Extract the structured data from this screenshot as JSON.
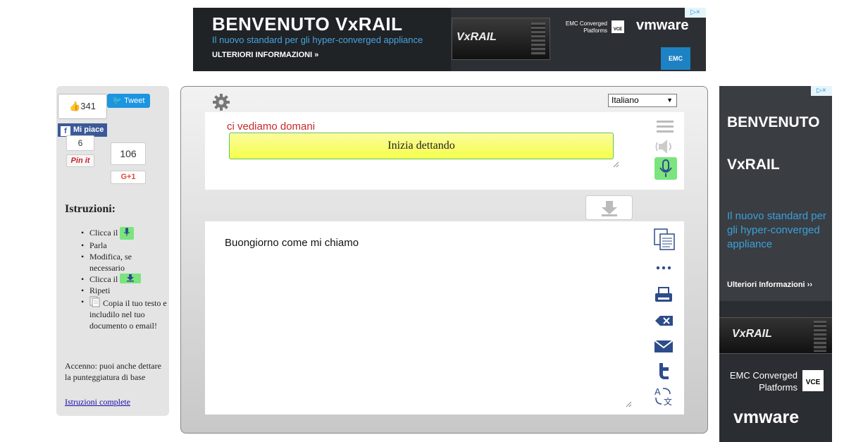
{
  "top_ad": {
    "headline": "BENVENUTO VxRAIL",
    "subtitle": "Il nuovo standard per gli hyper-converged appliance",
    "cta": "ULTERIORI INFORMAZIONI »",
    "product_brand": "VxRAIL",
    "emc_converged": "EMC Converged Platforms",
    "vce": "VCE",
    "vmware": "vmware",
    "emc": "EMC",
    "adchoices": "▷×"
  },
  "social": {
    "fb_count": "341",
    "tweet_label": "Tweet",
    "fb_like_label": "Mi piace",
    "pin_count": "6",
    "pin_label": "Pin it",
    "gplus_count": "106",
    "gplus_label": "G+1"
  },
  "instructions": {
    "title": "Istruzioni:",
    "steps": [
      "Clicca il",
      "Parla",
      "Modifica, se necessario",
      "Clicca il",
      "Ripeti",
      "Copia il tuo testo e includilo nel tuo documento o email!"
    ],
    "hint": "Accenno: puoi anche dettare la punteggiatura di base",
    "full_link": "Istruzioni complete"
  },
  "dictation": {
    "language": "Italiano",
    "interim_text": "ci vediamo domani",
    "start_button": "Inizia dettando",
    "result_text": "Buongiorno come mi chiamo"
  },
  "side_ad": {
    "headline_1": "BENVENUTO",
    "headline_2": "VxRAIL",
    "subtitle": "Il nuovo standard per gli hyper-converged appliance",
    "cta": "Ulteriori Informazioni ››",
    "product_brand": "VxRAIL",
    "emc_converged": "EMC Converged Platforms",
    "vce": "VCE",
    "vmware": "vmware",
    "adchoices": "▷×"
  },
  "colors": {
    "accent_green": "#7be47e",
    "icon_blue": "#2d4c8a",
    "interim_red": "#c8282d",
    "start_yellow": "#f5ff4a"
  }
}
